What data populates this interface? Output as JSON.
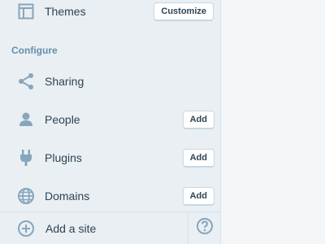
{
  "sidebar": {
    "themes": {
      "label": "Themes",
      "button": "Customize"
    },
    "section_header": "Configure",
    "items": [
      {
        "label": "Sharing",
        "button": null
      },
      {
        "label": "People",
        "button": "Add"
      },
      {
        "label": "Plugins",
        "button": "Add"
      },
      {
        "label": "Domains",
        "button": "Add"
      }
    ],
    "footer": {
      "add_site_label": "Add a site"
    }
  },
  "colors": {
    "icon": "#87a6bc",
    "text": "#2e4453",
    "section_header": "#668eaa",
    "sidebar_bg": "#e9eff3",
    "main_bg": "#f3f6f8"
  }
}
